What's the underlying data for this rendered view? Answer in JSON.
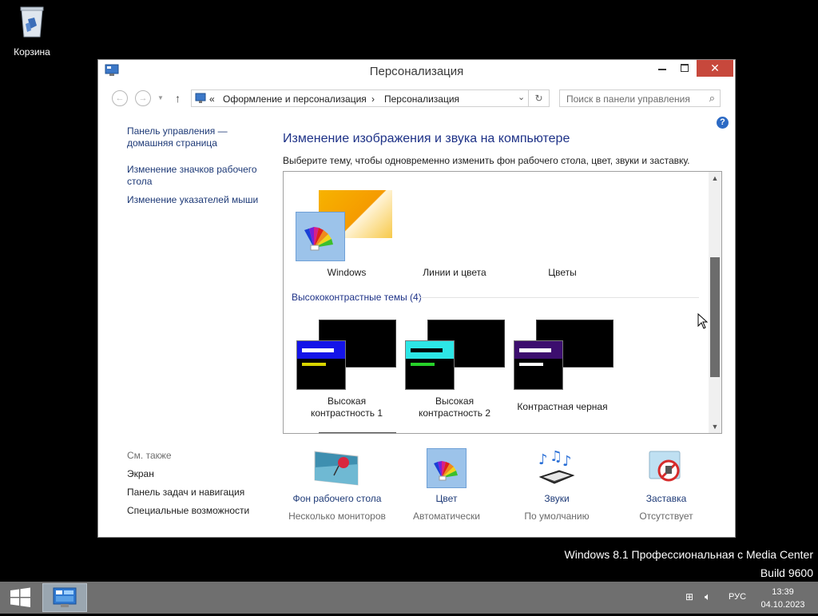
{
  "desktop": {
    "recycle_bin_label": "Корзина"
  },
  "window": {
    "title": "Персонализация",
    "breadcrumb": {
      "sep_root": "«",
      "item1": "Оформление и персонализация",
      "arrow": "›",
      "item2": "Персонализация"
    },
    "search_placeholder": "Поиск в панели управления"
  },
  "left_pane": {
    "links": [
      "Панель управления —",
      "домашняя страница",
      "Изменение значков рабочего",
      "стола",
      "Изменение указателей мыши"
    ],
    "see_also_title": "См. также",
    "see_also": [
      "Экран",
      "Панель задач и навигация",
      "Специальные возможности"
    ]
  },
  "main": {
    "title": "Изменение изображения и звука на компьютере",
    "description": "Выберите тему, чтобы одновременно изменить фон рабочего стола, цвет, звуки и заставку.",
    "windows_themes": [
      "Windows",
      "Линии и цвета",
      "Цветы"
    ],
    "hc_group_header": "Высококонтрастные темы (4)",
    "hc_themes": [
      {
        "line1": "Высокая",
        "line2": "контрастность 1"
      },
      {
        "line1": "Высокая",
        "line2": "контрастность 2"
      },
      {
        "line1": "Контрастная черная",
        "line2": ""
      }
    ]
  },
  "bottom": [
    {
      "link": "Фон рабочего стола",
      "sub": "Несколько мониторов",
      "icon": "wallpaper-icon"
    },
    {
      "link": "Цвет",
      "sub": "Автоматически",
      "icon": "color-icon"
    },
    {
      "link": "Звуки",
      "sub": "По умолчанию",
      "icon": "sounds-icon"
    },
    {
      "link": "Заставка",
      "sub": "Отсутствует",
      "icon": "screensaver-icon"
    }
  ],
  "watermark": {
    "line1": "Windows 8.1 Профессиональная с Media Center",
    "line2": "Build 9600"
  },
  "taskbar": {
    "lang": "РУС",
    "time": "13:39",
    "date": "04.10.2023"
  },
  "colors": {
    "link": "#1e3a77",
    "heading": "#1e3287",
    "close_button": "#c7483c",
    "taskbar": "#6f6f6f"
  }
}
